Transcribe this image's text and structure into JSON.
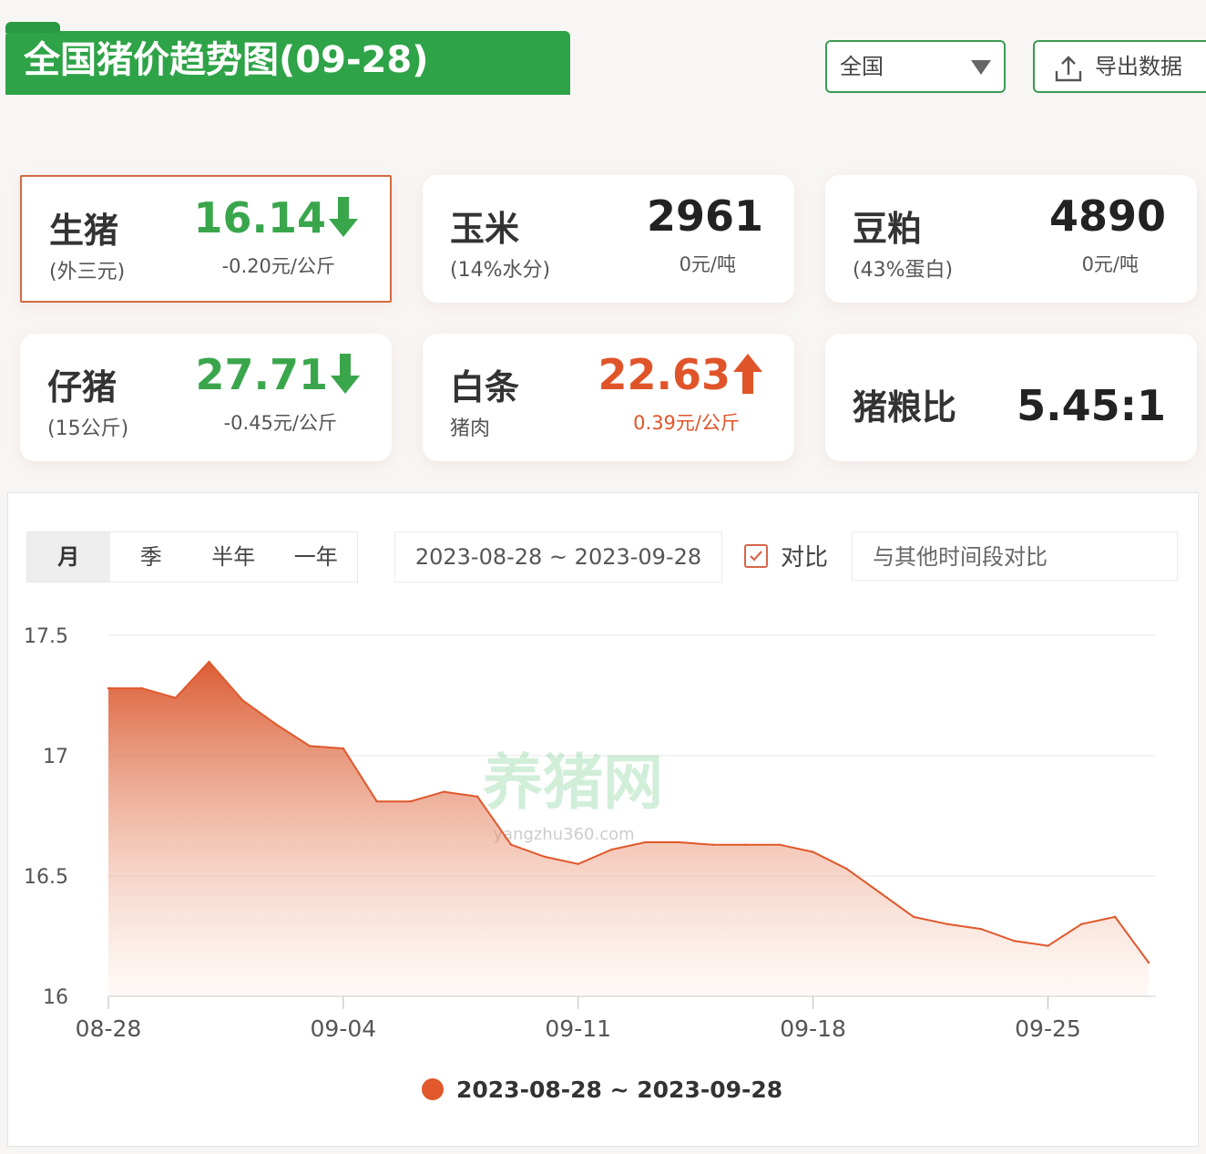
{
  "header": {
    "title": "全国猪价趋势图(09-28)",
    "region": "全国",
    "export_label": "导出数据"
  },
  "cards": [
    {
      "name": "生猪",
      "sub": "(外三元)",
      "value": "16.14",
      "change": "-0.20元/公斤",
      "trend": "down",
      "selected": true
    },
    {
      "name": "玉米",
      "sub": "(14%水分)",
      "value": "2961",
      "change": "0元/吨",
      "trend": "flat"
    },
    {
      "name": "豆粕",
      "sub": "(43%蛋白)",
      "value": "4890",
      "change": "0元/吨",
      "trend": "flat"
    },
    {
      "name": "仔猪",
      "sub": "(15公斤)",
      "value": "27.71",
      "change": "-0.45元/公斤",
      "trend": "down"
    },
    {
      "name": "白条",
      "sub": "猪肉",
      "value": "22.63",
      "change": "0.39元/公斤",
      "trend": "up"
    },
    {
      "name": "猪粮比",
      "value": "5.45:1"
    }
  ],
  "controls": {
    "tabs": [
      "月",
      "季",
      "半年",
      "一年"
    ],
    "active_tab": "月",
    "date_range": "2023-08-28 ~ 2023-09-28",
    "compare_label": "对比",
    "compare_placeholder": "与其他时间段对比"
  },
  "colors": {
    "brand_green": "#2ea347",
    "down_green": "#3aa64c",
    "up_red": "#e0542a",
    "series": "#e0582c"
  },
  "chart_data": {
    "type": "area",
    "x": [
      "08-28",
      "08-29",
      "08-30",
      "08-31",
      "09-01",
      "09-02",
      "09-03",
      "09-04",
      "09-05",
      "09-06",
      "09-07",
      "09-08",
      "09-09",
      "09-10",
      "09-11",
      "09-12",
      "09-13",
      "09-14",
      "09-15",
      "09-16",
      "09-17",
      "09-18",
      "09-19",
      "09-20",
      "09-21",
      "09-22",
      "09-23",
      "09-24",
      "09-25",
      "09-26",
      "09-27",
      "09-28"
    ],
    "x_ticks": [
      "08-28",
      "09-04",
      "09-11",
      "09-18",
      "09-25"
    ],
    "y_ticks": [
      "17.5",
      "17",
      "16.5",
      "16"
    ],
    "ylim": [
      16,
      17.5
    ],
    "series": [
      {
        "name": "2023-08-28 ~ 2023-09-28",
        "values": [
          17.28,
          17.28,
          17.24,
          17.39,
          17.23,
          17.13,
          17.04,
          17.03,
          16.81,
          16.81,
          16.85,
          16.83,
          16.63,
          16.58,
          16.55,
          16.61,
          16.64,
          16.64,
          16.63,
          16.63,
          16.63,
          16.6,
          16.53,
          16.43,
          16.33,
          16.3,
          16.28,
          16.23,
          16.21,
          16.3,
          16.33,
          16.14
        ]
      }
    ],
    "watermark": "养猪网",
    "watermark_url": "yangzhu360.com",
    "grid": true,
    "legend": "bottom"
  }
}
